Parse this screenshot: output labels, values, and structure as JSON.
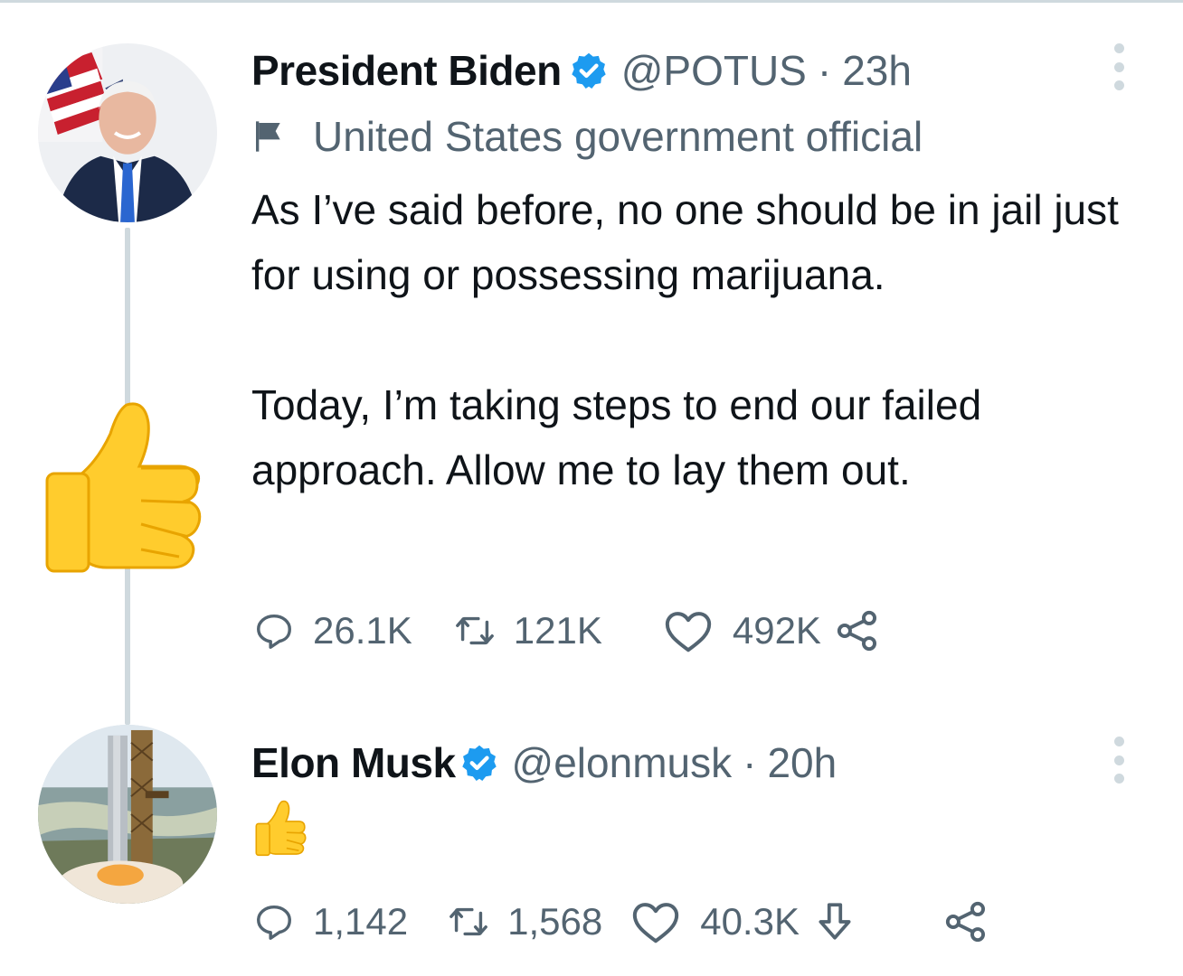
{
  "tweets": [
    {
      "author": "President Biden",
      "handle": "@POTUS",
      "separator": "·",
      "time": "23h",
      "label": "United States government official",
      "text_para1": "As I’ve said before, no one should be in jail just for using or possessing marijuana.",
      "text_para2": "Today, I’m taking steps to end our failed approach. Allow me to lay them out.",
      "replies": "26.1K",
      "retweets": "121K",
      "likes": "492K",
      "icons": [
        "verified-badge-icon",
        "flag-icon",
        "reply-icon",
        "retweet-icon",
        "like-icon",
        "share-icon",
        "more-icon",
        "thumbs-up-icon"
      ]
    },
    {
      "author": "Elon Musk",
      "handle": "@elonmusk",
      "separator": "·",
      "time": "20h",
      "replies": "1,142",
      "retweets": "1,568",
      "likes": "40.3K",
      "icons": [
        "verified-badge-icon",
        "thumbs-up-icon",
        "reply-icon",
        "retweet-icon",
        "like-icon",
        "download-icon",
        "share-icon",
        "more-icon"
      ]
    }
  ],
  "colors": {
    "text_primary": "#0f1419",
    "text_secondary": "#536471",
    "verified_blue": "#1d9bf0",
    "thread_line": "#cfd9de",
    "emoji_yellow": "#ffcc2d"
  }
}
